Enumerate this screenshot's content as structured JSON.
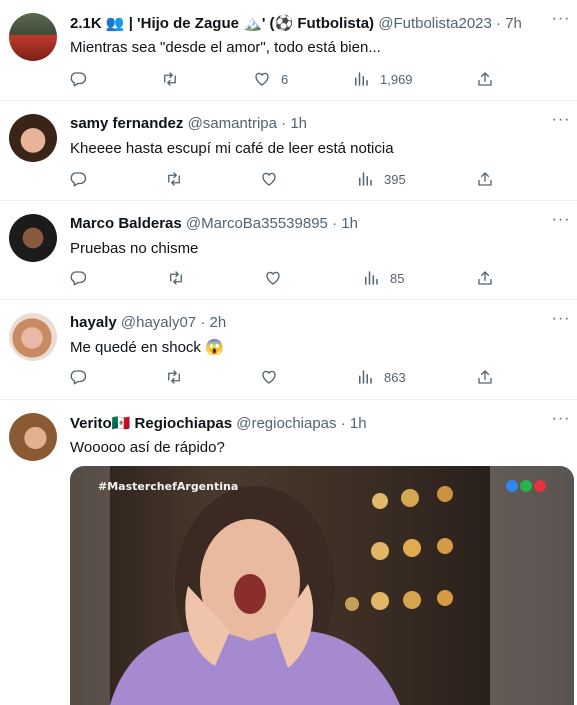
{
  "tweets": [
    {
      "display_name": "2.1K 👥 | 'Hijo de Zague 🏔️' (⚽ Futbolista)",
      "handle": "@Futbolista2023",
      "time": "7h",
      "text": "Mientras sea \"desde el amor\", todo está bien...",
      "likes": "6",
      "views": "1,969"
    },
    {
      "display_name": "samy fernandez",
      "handle": "@samantripa",
      "time": "1h",
      "text": "Kheeee hasta escupí mi café de leer está noticia",
      "likes": "",
      "views": "395"
    },
    {
      "display_name": "Marco Balderas",
      "handle": "@MarcoBa35539895",
      "time": "1h",
      "text": "Pruebas no chisme",
      "likes": "",
      "views": "85"
    },
    {
      "display_name": "hayaly",
      "handle": "@hayaly07",
      "time": "2h",
      "text": "Me quedé en shock 😱",
      "likes": "",
      "views": "863"
    },
    {
      "display_name": "Verito🇲🇽 Regiochiapas",
      "handle": "@regiochiapas",
      "time": "1h",
      "text": "Wooooo así de rápido?",
      "media_hashtag": "#MasterchefArgentina"
    }
  ],
  "separator": "·",
  "more_label": "···",
  "icons": {
    "reply": "reply-icon",
    "retweet": "retweet-icon",
    "like": "like-icon",
    "views": "views-icon",
    "share": "share-icon",
    "more": "more-icon"
  },
  "colors": {
    "muted": "#536471",
    "text": "#0f1419",
    "divider": "#eff3f4"
  }
}
